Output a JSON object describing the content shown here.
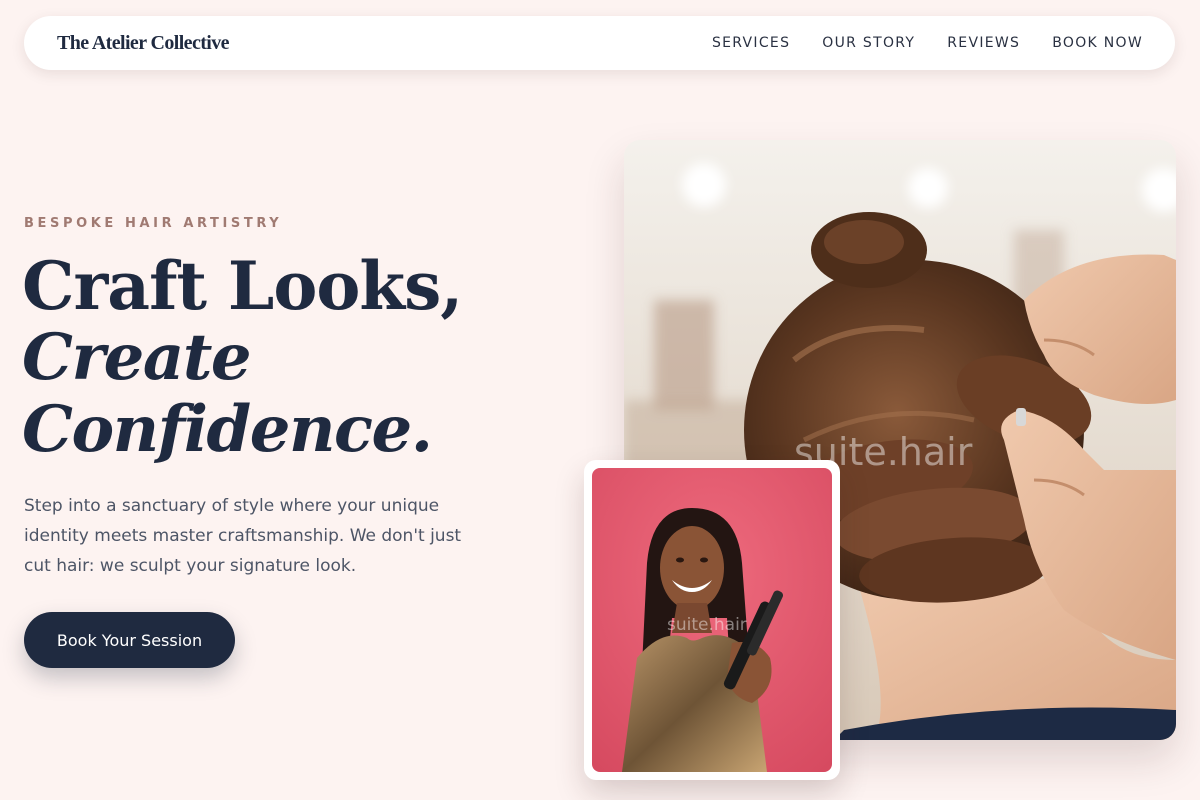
{
  "header": {
    "brand": "The Atelier Collective",
    "nav": [
      {
        "label": "SERVICES"
      },
      {
        "label": "OUR STORY"
      },
      {
        "label": "REVIEWS"
      },
      {
        "label": "BOOK NOW"
      }
    ]
  },
  "hero": {
    "eyebrow": "BESPOKE HAIR ARTISTRY",
    "headline_line1": "Craft Looks,",
    "headline_line2": "Create",
    "headline_line3": "Confidence.",
    "body": "Step into a sanctuary of style where your unique identity meets master craftsmanship. We don't just cut hair: we sculpt your signature look.",
    "cta_label": "Book Your Session"
  },
  "images": {
    "main_watermark": "suite.hair",
    "inset_watermark": "suite.hair"
  },
  "colors": {
    "background": "#fdf3f1",
    "navy": "#1f2a40",
    "eyebrow": "#a07a72",
    "inset_backdrop": "#e2566b"
  }
}
